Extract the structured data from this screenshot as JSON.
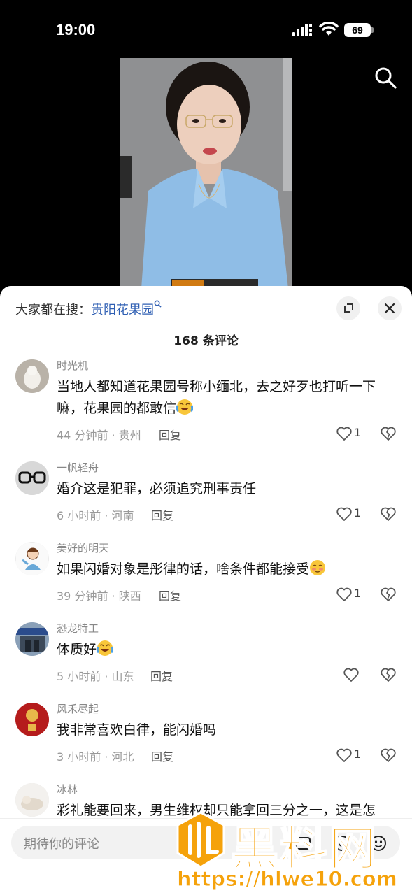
{
  "status_bar": {
    "time": "19:00",
    "battery": "69"
  },
  "video": {
    "caption_fragment": ""
  },
  "sheet": {
    "search_prefix": "大家都在搜：",
    "search_keyword": "贵阳花果园",
    "comment_count": "168 条评论"
  },
  "comments": [
    {
      "user": "时光机",
      "text": "当地人都知道花果园号称小缅北，去之好歹也打听一下嘛，花果园的都敢信",
      "emoji": "crying-laughing-emoji",
      "meta": "44 分钟前 · 贵州",
      "reply": "回复",
      "likes": "1"
    },
    {
      "user": "一帆轻舟",
      "text": "婚介这是犯罪，必须追究刑事责任",
      "emoji": "",
      "meta": "6 小时前 · 河南",
      "reply": "回复",
      "likes": "1"
    },
    {
      "user": "美好的明天",
      "text": "如果闪婚对象是彤律的话，啥条件都能接受",
      "emoji": "shy-emoji",
      "meta": "39 分钟前 · 陕西",
      "reply": "回复",
      "likes": "1"
    },
    {
      "user": "恐龙特工",
      "text": "体质好",
      "emoji": "crying-laughing-emoji",
      "meta": "5 小时前 · 山东",
      "reply": "回复",
      "likes": ""
    },
    {
      "user": "风禾尽起",
      "text": "我非常喜欢白律，能闪婚吗",
      "emoji": "",
      "meta": "3 小时前 · 河北",
      "reply": "回复",
      "likes": "1"
    },
    {
      "user": "冰林",
      "text": "彩礼能要回来，男生维权却只能拿回三分之一，这是怎",
      "emoji": "",
      "meta": "",
      "reply": "",
      "likes": ""
    }
  ],
  "input": {
    "placeholder": "期待你的评论"
  },
  "watermark": {
    "title": "黑料网",
    "url": "https://hlwe10.com"
  },
  "colors": {
    "link": "#2f5fb3",
    "watermark": "#f5a20b",
    "sheet_bg": "#ffffff",
    "page_bg": "#000000"
  }
}
